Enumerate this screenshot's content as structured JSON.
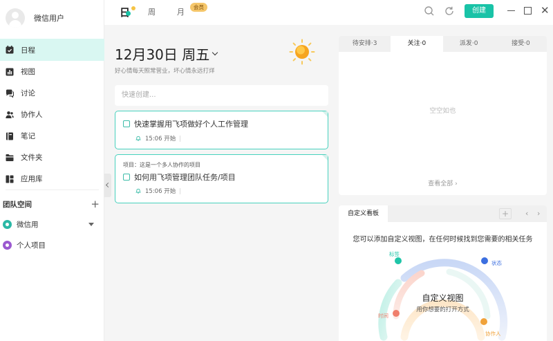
{
  "user": {
    "name": "微信用户"
  },
  "nav": [
    {
      "label": "日程",
      "icon": "calendar-icon",
      "active": true
    },
    {
      "label": "视图",
      "icon": "chart-icon"
    },
    {
      "label": "讨论",
      "icon": "chat-icon"
    },
    {
      "label": "协作人",
      "icon": "people-icon"
    },
    {
      "label": "笔记",
      "icon": "note-icon"
    },
    {
      "label": "文件夹",
      "icon": "folder-icon"
    },
    {
      "label": "应用库",
      "icon": "apps-icon"
    }
  ],
  "team": {
    "title": "团队空间",
    "items": [
      {
        "label": "微信用",
        "color": "#2bb8a6"
      },
      {
        "label": "个人项目",
        "color": "#9b59d0"
      }
    ]
  },
  "topbar": {
    "day": "日",
    "week": "周",
    "month": "月",
    "vip": "会员",
    "create": "创建"
  },
  "schedule": {
    "date": "12月30日 周五",
    "subtitle": "好心情每天照常营业，坏心情永远打烊",
    "quick_placeholder": "快速创建...",
    "tasks": [
      {
        "project": "",
        "title": "快速掌握用飞项做好个人工作管理",
        "time": "15:06 开始"
      },
      {
        "project": "项目：这是一个多人协作的项目",
        "title": "如何用飞项管理团队任务/项目",
        "time": "15:06 开始"
      }
    ]
  },
  "panel": {
    "tabs": [
      "待安排·3",
      "关注·0",
      "派发·0",
      "接受·0"
    ],
    "active_tab": 1,
    "empty": "空空如也",
    "view_all": "查看全部"
  },
  "board": {
    "tab": "自定义看板",
    "desc": "您可以添加自定义视图，在任何时候找到您需要的相关任务",
    "title": "自定义视图",
    "subtitle": "用你想要的打开方式",
    "labels": [
      {
        "text": "标签",
        "color": "#1fc5a8"
      },
      {
        "text": "状态",
        "color": "#3c6fe0"
      },
      {
        "text": "时间",
        "color": "#f07f6c"
      },
      {
        "text": "协作人",
        "color": "#f0a23a"
      }
    ]
  }
}
